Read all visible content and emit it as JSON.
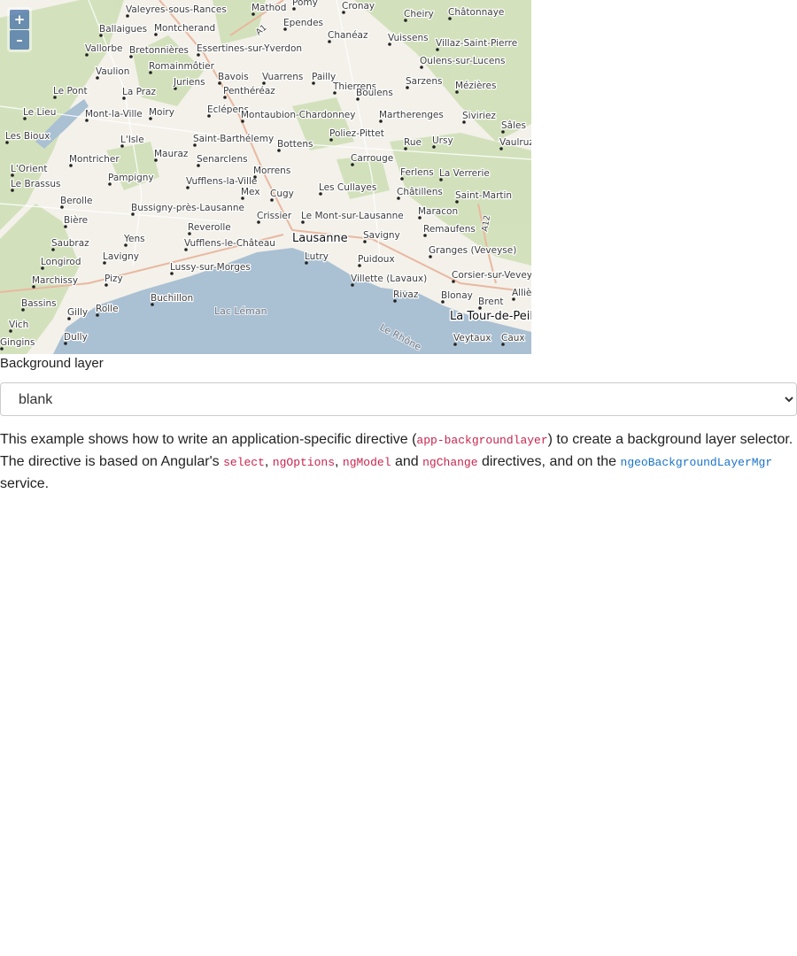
{
  "map": {
    "zoom_in_label": "+",
    "zoom_out_label": "–",
    "places": [
      "Valeyres-sous-Rances",
      "Mathod",
      "Pomy",
      "Cronay",
      "Châtonnaye",
      "Ballaigues",
      "Montcherand",
      "Ependes",
      "Chanéaz",
      "Cheiry",
      "Vuissens",
      "Villaz-Saint-Pierre",
      "Vallorbe",
      "Bretonnières",
      "Essertines-sur-Yverdon",
      "Oulens-sur-Lucens",
      "Vaulion",
      "Romainmôtier",
      "Bavois",
      "Vuarrens",
      "Pailly",
      "Thierrens",
      "Sarzens",
      "Mézières",
      "Juriens",
      "Le Pont",
      "La Praz",
      "Penthéréaz",
      "Boulens",
      "Siviriez",
      "Le Lieu",
      "Mont-la-Ville",
      "Moiry",
      "Eclépens",
      "Montaubion-Chardonney",
      "Martherenges",
      "Sâles",
      "Les Bioux",
      "L'Isle",
      "Saint-Barthélemy",
      "Bottens",
      "Poliez-Pittet",
      "Rue",
      "Ursy",
      "Vaulruz",
      "Montricher",
      "Mauraz",
      "Senarclens",
      "Carrouge",
      "L'Orient",
      "Le Brassus",
      "Pampigny",
      "Vufflens-la-Ville",
      "Morrens",
      "Ferlens",
      "La Verrerie",
      "Mex",
      "Cugy",
      "Les Cullayes",
      "Châtillens",
      "Saint-Martin",
      "Berolle",
      "Bussigny-près-Lausanne",
      "Crissier",
      "Le Mont-sur-Lausanne",
      "Maracon",
      "Bière",
      "Reverolle",
      "Savigny",
      "Remaufens",
      "Yens",
      "Saubraz",
      "Vufflens-le-Château",
      "Granges (Veveyse)",
      "Lavigny",
      "Lutry",
      "Longirod",
      "Lussy-sur-Morges",
      "Puidoux",
      "Corsier-sur-Vevey",
      "Marchissy",
      "Pizy",
      "Villette (Lavaux)",
      "Allières",
      "Bassins",
      "Buchillon",
      "Rivaz",
      "Blonay",
      "Rolle",
      "Brent",
      "Gilly",
      "Vich",
      "Dully",
      "Veytaux",
      "Caux",
      "Gingins"
    ],
    "city": "Lausanne",
    "lake_label": "Lac Léman",
    "river_label": "Le Rhône",
    "big_town": "La Tour-de-Peilz",
    "roads": [
      "A1",
      "A12"
    ],
    "colors": {
      "water": "#aac0d3",
      "forest": "#cfe0b8",
      "land": "#f3f1ea"
    }
  },
  "form": {
    "label": "Background layer",
    "selected": "blank",
    "options": [
      "blank"
    ]
  },
  "description": {
    "t1": "This example shows how to write an application-specific directive (",
    "c1": "app-backgroundlayer",
    "t2": ") to create a background layer selector. The directive is based on Angular's ",
    "c2": "select",
    "t3": ", ",
    "c3": "ngOptions",
    "t4": ", ",
    "c4": "ngModel",
    "t5": " and ",
    "c5": "ngChange",
    "t6": " directives, and on the ",
    "c6": "ngeoBackgroundLayerMgr",
    "t7": " service."
  }
}
